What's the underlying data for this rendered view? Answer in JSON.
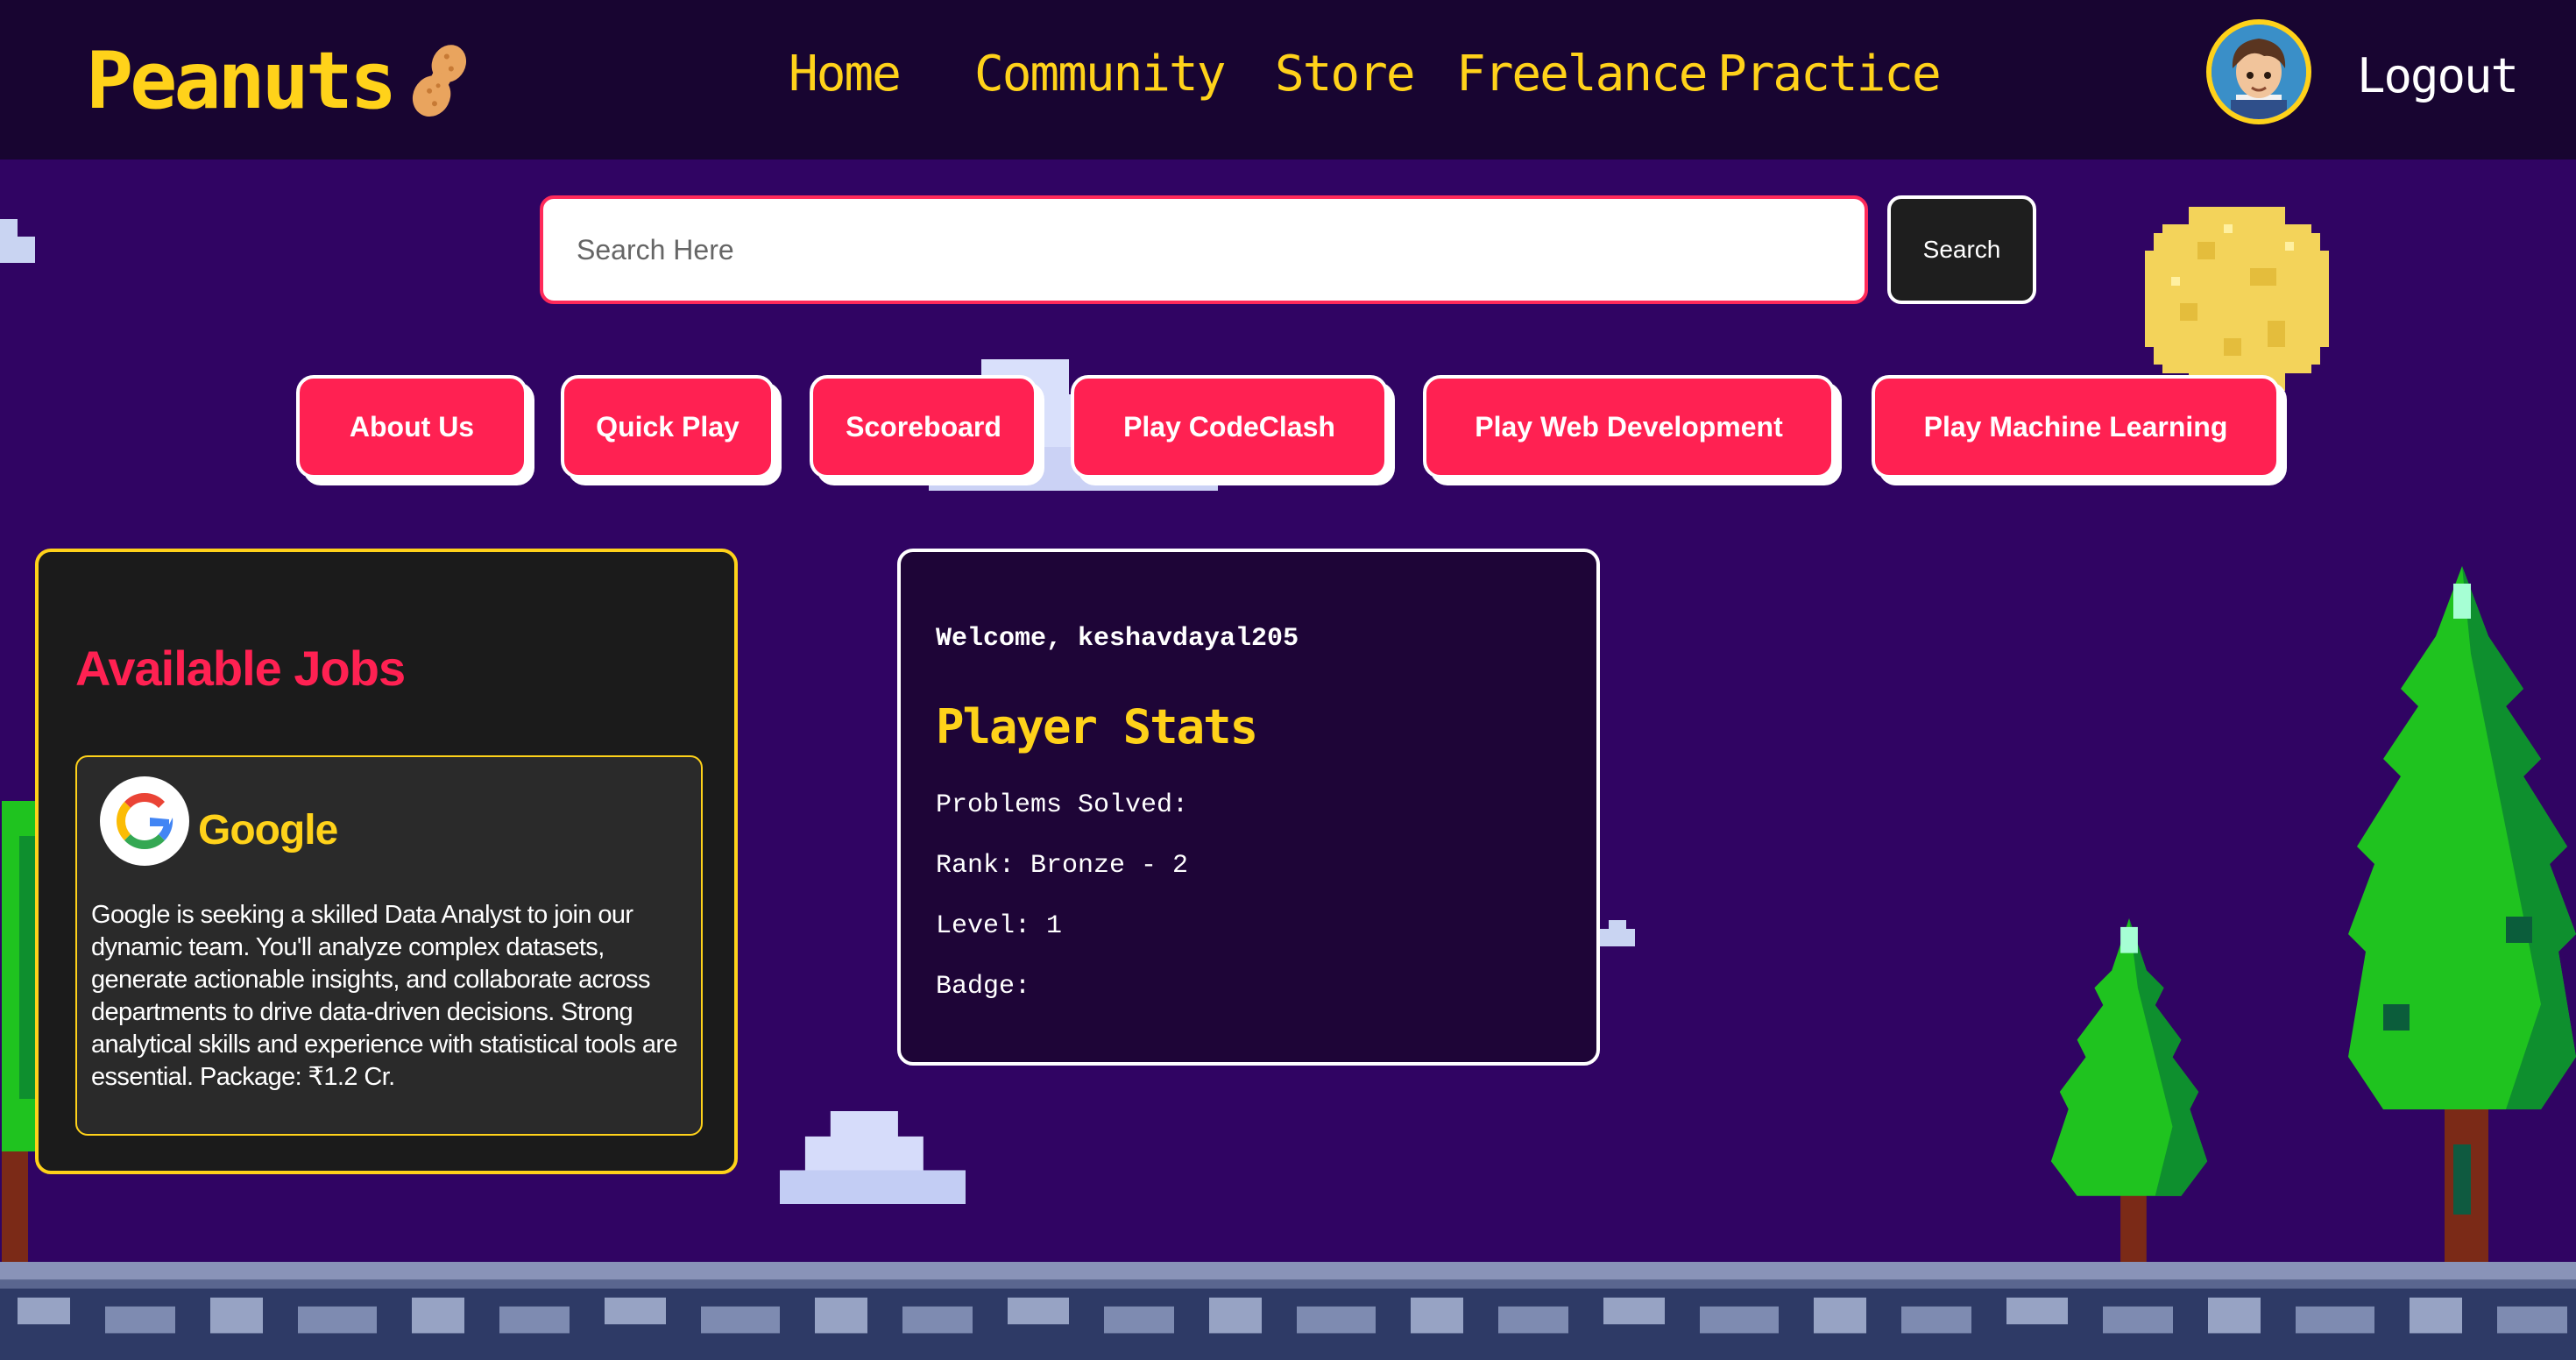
{
  "colors": {
    "background": "#300463",
    "navbar": "#180531",
    "accent_yellow": "#ffd21a",
    "accent_red": "#ff2152",
    "panel_dark": "#1b1b1b",
    "stats_panel": "#1e0537"
  },
  "navbar": {
    "brand": "Peanuts",
    "brand_icon": "peanut-icon",
    "links": [
      "Home",
      "Community",
      "Store",
      "Freelance",
      "Practice"
    ],
    "avatar_icon": "user-avatar",
    "logout_label": "Logout"
  },
  "search": {
    "placeholder": "Search Here",
    "value": "",
    "button_label": "Search"
  },
  "actions": [
    "About Us",
    "Quick Play",
    "Scoreboard",
    "Play CodeClash",
    "Play Web Development",
    "Play Machine Learning"
  ],
  "jobs": {
    "title": "Available Jobs",
    "items": [
      {
        "company": "Google",
        "logo_icon": "google-logo-icon",
        "description": "Google is seeking a skilled Data Analyst to join our dynamic team. You'll analyze complex datasets, generate actionable insights, and collaborate across departments to drive data-driven decisions. Strong analytical skills and experience with statistical tools are essential. Package: ₹1.2 Cr."
      }
    ]
  },
  "player": {
    "welcome": "Welcome, keshavdayal205",
    "stats_title": "Player Stats",
    "stats": [
      "Problems Solved:",
      "Rank: Bronze - 2",
      "Level: 1",
      "Badge:"
    ]
  }
}
